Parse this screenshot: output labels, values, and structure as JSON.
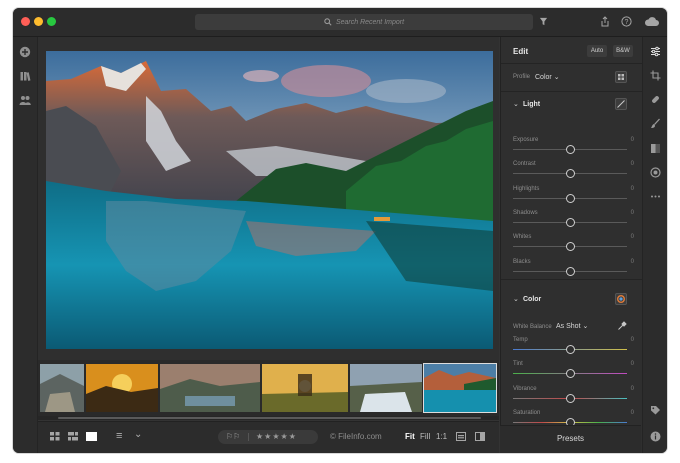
{
  "titlebar": {
    "search_placeholder": "Search Recent Import",
    "icons": [
      "filter-icon",
      "share-icon",
      "help-icon",
      "cloud-icon"
    ]
  },
  "leftbar": {
    "icons": [
      "add-photos-icon",
      "library-icon",
      "people-icon"
    ]
  },
  "photo": {
    "filmstrip_selected_index": 5,
    "filmstrip_thumbs": 6
  },
  "bottombar": {
    "copyright": "© FileInfo.com",
    "zoom": {
      "fit": "Fit",
      "fill": "Fill",
      "one_to_one": "1:1"
    },
    "stars": "★★★★★",
    "flags": "⚐⚐",
    "sort_icon": "≡",
    "sort_chevron": "⌄"
  },
  "edit_panel": {
    "title": "Edit",
    "auto_label": "Auto",
    "bw_label": "B&W",
    "profile_label": "Profile",
    "profile_value": "Color",
    "light": {
      "title": "Light",
      "sliders": [
        {
          "label": "Exposure",
          "value": "0",
          "pos": 0.5
        },
        {
          "label": "Contrast",
          "value": "0",
          "pos": 0.5
        },
        {
          "label": "Highlights",
          "value": "0",
          "pos": 0.5
        },
        {
          "label": "Shadows",
          "value": "0",
          "pos": 0.5
        },
        {
          "label": "Whites",
          "value": "0",
          "pos": 0.5
        },
        {
          "label": "Blacks",
          "value": "0",
          "pos": 0.5
        }
      ]
    },
    "color": {
      "title": "Color",
      "white_balance_label": "White Balance",
      "white_balance_value": "As Shot",
      "sliders": [
        {
          "label": "Temp",
          "value": "0",
          "pos": 0.5
        },
        {
          "label": "Tint",
          "value": "0",
          "pos": 0.5
        },
        {
          "label": "Vibrance",
          "value": "0",
          "pos": 0.5
        },
        {
          "label": "Saturation",
          "value": "0",
          "pos": 0.5
        }
      ]
    },
    "presets_label": "Presets"
  },
  "rightstrip": {
    "icons": [
      "edit-sliders-icon",
      "crop-icon",
      "healing-icon",
      "brush-icon",
      "linear-gradient-icon",
      "radial-gradient-icon",
      "more-icon",
      "tag-icon",
      "info-icon"
    ]
  }
}
